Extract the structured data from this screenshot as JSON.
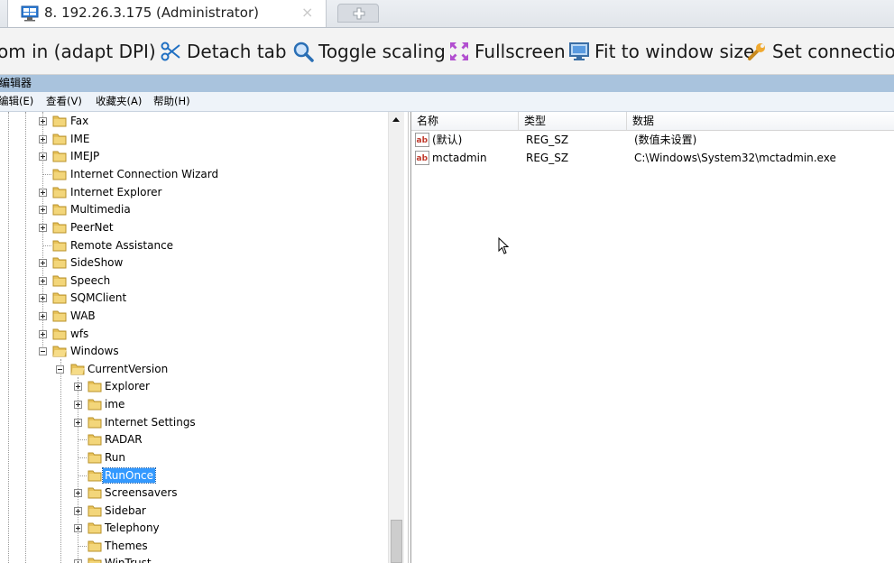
{
  "tabs": {
    "active_title": "8. 192.26.3.175 (Administrator)",
    "close_glyph": "×",
    "new_tab_glyph": "+"
  },
  "toolbar": {
    "items": [
      {
        "label": "om in (adapt DPI)",
        "icon": "none"
      },
      {
        "label": "Detach tab",
        "icon": "scissors-icon"
      },
      {
        "label": "Toggle scaling",
        "icon": "magnifier-icon"
      },
      {
        "label": "Fullscreen",
        "icon": "fullscreen-icon"
      },
      {
        "label": "Fit to window size",
        "icon": "monitor-icon"
      },
      {
        "label": "Set connection",
        "icon": "wrench-icon"
      }
    ]
  },
  "window": {
    "title": "编辑器"
  },
  "menu": {
    "edit": "编辑(E)",
    "view": "查看(V)",
    "favorites": "收藏夹(A)",
    "help": "帮助(H)"
  },
  "tree": {
    "nodes": [
      {
        "label": "Fax"
      },
      {
        "label": "IME"
      },
      {
        "label": "IMEJP"
      },
      {
        "label": "Internet Connection Wizard"
      },
      {
        "label": "Internet Explorer"
      },
      {
        "label": "Multimedia"
      },
      {
        "label": "PeerNet"
      },
      {
        "label": "Remote Assistance"
      },
      {
        "label": "SideShow"
      },
      {
        "label": "Speech"
      },
      {
        "label": "SQMClient"
      },
      {
        "label": "WAB"
      },
      {
        "label": "wfs"
      },
      {
        "label": "Windows"
      },
      {
        "label": "CurrentVersion"
      },
      {
        "label": "Explorer"
      },
      {
        "label": "ime"
      },
      {
        "label": "Internet Settings"
      },
      {
        "label": "RADAR"
      },
      {
        "label": "Run"
      },
      {
        "label": "RunOnce"
      },
      {
        "label": "Screensavers"
      },
      {
        "label": "Sidebar"
      },
      {
        "label": "Telephony"
      },
      {
        "label": "Themes"
      },
      {
        "label": "WinTrust"
      }
    ],
    "selected": "RunOnce"
  },
  "list": {
    "columns": [
      "名称",
      "类型",
      "数据"
    ],
    "rows": [
      {
        "name": "(默认)",
        "type": "REG_SZ",
        "data": "(数值未设置)"
      },
      {
        "name": "mctadmin",
        "type": "REG_SZ",
        "data": "C:\\Windows\\System32\\mctadmin.exe"
      }
    ]
  },
  "colors": {
    "titlebar": "#a9c3dd",
    "selection": "#3399ff",
    "folder": "#e8c25a"
  }
}
